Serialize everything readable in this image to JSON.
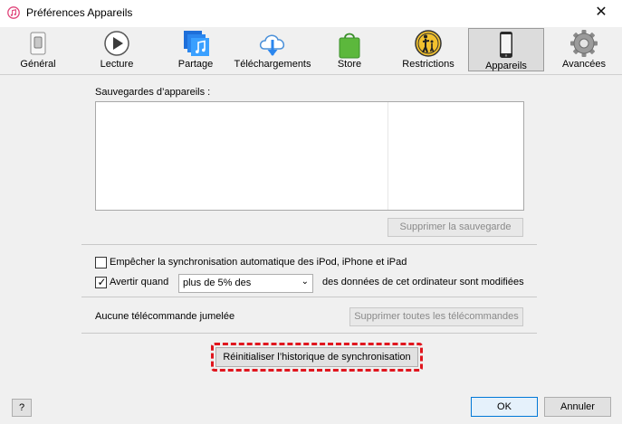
{
  "window": {
    "title": "Préférences Appareils",
    "close_label": "✕",
    "app_icon": "itunes-icon"
  },
  "toolbar": {
    "items": [
      {
        "label": "Général",
        "icon": "general-switch-icon"
      },
      {
        "label": "Lecture",
        "icon": "play-icon"
      },
      {
        "label": "Partage",
        "icon": "share-music-icon"
      },
      {
        "label": "Téléchargements",
        "icon": "cloud-download-icon"
      },
      {
        "label": "Store",
        "icon": "store-bag-icon"
      },
      {
        "label": "Restrictions",
        "icon": "parental-restriction-icon"
      },
      {
        "label": "Appareils",
        "icon": "device-phone-icon",
        "selected": true
      },
      {
        "label": "Avancées",
        "icon": "gear-icon"
      }
    ]
  },
  "backups": {
    "heading": "Sauvegardes d’appareils :",
    "delete_label": "Supprimer la sauvegarde"
  },
  "sync": {
    "prevent_label": "Empêcher la synchronisation automatique des iPod, iPhone et iPad",
    "prevent_checked": false,
    "warn_label": "Avertir quand",
    "warn_checked": true,
    "threshold_value": "plus de 5% des",
    "warn_suffix": "des données de cet ordinateur sont modifiées"
  },
  "remotes": {
    "status": "Aucune télécommande jumelée",
    "remove_all_label": "Supprimer toutes les télécommandes"
  },
  "reset_label": "Réinitialiser l’historique de synchronisation",
  "footer": {
    "help_label": "?",
    "ok_label": "OK",
    "cancel_label": "Annuler"
  },
  "colors": {
    "highlight_border": "#e0161e",
    "primary_border": "#0078d7"
  }
}
